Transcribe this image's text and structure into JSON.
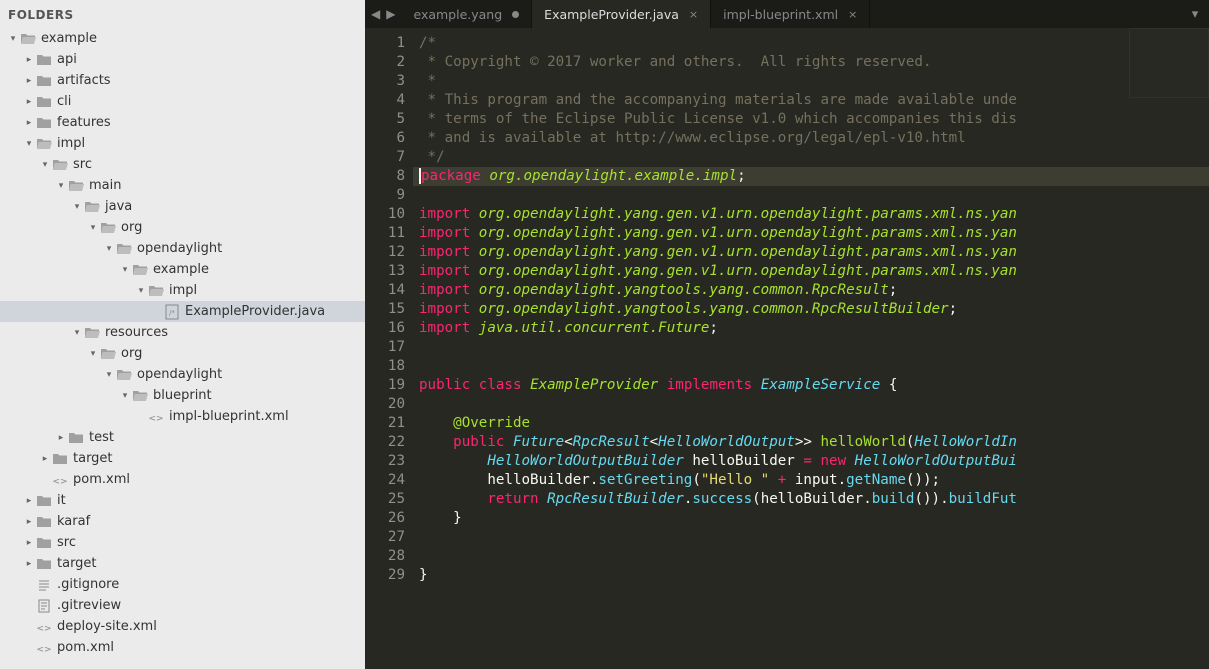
{
  "sidebar": {
    "title": "FOLDERS",
    "tree": [
      {
        "depth": 0,
        "disclosure": "down",
        "icon": "folder-open",
        "label": "example"
      },
      {
        "depth": 1,
        "disclosure": "right",
        "icon": "folder",
        "label": "api"
      },
      {
        "depth": 1,
        "disclosure": "right",
        "icon": "folder",
        "label": "artifacts"
      },
      {
        "depth": 1,
        "disclosure": "right",
        "icon": "folder",
        "label": "cli"
      },
      {
        "depth": 1,
        "disclosure": "right",
        "icon": "folder",
        "label": "features"
      },
      {
        "depth": 1,
        "disclosure": "down",
        "icon": "folder-open",
        "label": "impl"
      },
      {
        "depth": 2,
        "disclosure": "down",
        "icon": "folder-open",
        "label": "src"
      },
      {
        "depth": 3,
        "disclosure": "down",
        "icon": "folder-open",
        "label": "main"
      },
      {
        "depth": 4,
        "disclosure": "down",
        "icon": "folder-open",
        "label": "java"
      },
      {
        "depth": 5,
        "disclosure": "down",
        "icon": "folder-open",
        "label": "org"
      },
      {
        "depth": 6,
        "disclosure": "down",
        "icon": "folder-open",
        "label": "opendaylight"
      },
      {
        "depth": 7,
        "disclosure": "down",
        "icon": "folder-open",
        "label": "example"
      },
      {
        "depth": 8,
        "disclosure": "down",
        "icon": "folder-open",
        "label": "impl"
      },
      {
        "depth": 9,
        "disclosure": "",
        "icon": "file-java",
        "label": "ExampleProvider.java",
        "selected": true
      },
      {
        "depth": 4,
        "disclosure": "down",
        "icon": "folder-open",
        "label": "resources"
      },
      {
        "depth": 5,
        "disclosure": "down",
        "icon": "folder-open",
        "label": "org"
      },
      {
        "depth": 6,
        "disclosure": "down",
        "icon": "folder-open",
        "label": "opendaylight"
      },
      {
        "depth": 7,
        "disclosure": "down",
        "icon": "folder-open",
        "label": "blueprint"
      },
      {
        "depth": 8,
        "disclosure": "",
        "icon": "file-xml",
        "label": "impl-blueprint.xml"
      },
      {
        "depth": 3,
        "disclosure": "right",
        "icon": "folder",
        "label": "test"
      },
      {
        "depth": 2,
        "disclosure": "right",
        "icon": "folder",
        "label": "target"
      },
      {
        "depth": 2,
        "disclosure": "",
        "icon": "file-xml",
        "label": "pom.xml"
      },
      {
        "depth": 1,
        "disclosure": "right",
        "icon": "folder",
        "label": "it"
      },
      {
        "depth": 1,
        "disclosure": "right",
        "icon": "folder",
        "label": "karaf"
      },
      {
        "depth": 1,
        "disclosure": "right",
        "icon": "folder",
        "label": "src"
      },
      {
        "depth": 1,
        "disclosure": "right",
        "icon": "folder",
        "label": "target"
      },
      {
        "depth": 1,
        "disclosure": "",
        "icon": "file-lines",
        "label": ".gitignore"
      },
      {
        "depth": 1,
        "disclosure": "",
        "icon": "file-text",
        "label": ".gitreview"
      },
      {
        "depth": 1,
        "disclosure": "",
        "icon": "file-xml",
        "label": "deploy-site.xml"
      },
      {
        "depth": 1,
        "disclosure": "",
        "icon": "file-xml",
        "label": "pom.xml"
      }
    ]
  },
  "tabs": [
    {
      "label": "example.yang",
      "state": "dirty"
    },
    {
      "label": "ExampleProvider.java",
      "state": "active"
    },
    {
      "label": "impl-blueprint.xml",
      "state": "normal"
    }
  ],
  "editor": {
    "active_line": 8,
    "lines": [
      {
        "n": 1,
        "mark": "",
        "tokens": [
          [
            "comment",
            "/*"
          ]
        ]
      },
      {
        "n": 2,
        "mark": "",
        "tokens": [
          [
            "comment",
            " * Copyright © 2017 worker and others.  All rights reserved."
          ]
        ]
      },
      {
        "n": 3,
        "mark": "",
        "tokens": [
          [
            "comment",
            " *"
          ]
        ]
      },
      {
        "n": 4,
        "mark": "",
        "tokens": [
          [
            "comment",
            " * This program and the accompanying materials are made available unde"
          ]
        ]
      },
      {
        "n": 5,
        "mark": "",
        "tokens": [
          [
            "comment",
            " * terms of the Eclipse Public License v1.0 which accompanies this dis"
          ]
        ]
      },
      {
        "n": 6,
        "mark": "",
        "tokens": [
          [
            "comment",
            " * and is available at http://www.eclipse.org/legal/epl-v10.html"
          ]
        ]
      },
      {
        "n": 7,
        "mark": "",
        "tokens": [
          [
            "comment",
            " */"
          ]
        ]
      },
      {
        "n": 8,
        "mark": "y",
        "tokens": [
          [
            "kw",
            "package"
          ],
          [
            "plain",
            " "
          ],
          [
            "ns",
            "org.opendaylight.example.impl"
          ],
          [
            "plain",
            ";"
          ]
        ]
      },
      {
        "n": 9,
        "mark": "",
        "tokens": []
      },
      {
        "n": 10,
        "mark": "y",
        "tokens": [
          [
            "kw",
            "import"
          ],
          [
            "plain",
            " "
          ],
          [
            "ns",
            "org.opendaylight.yang.gen.v1.urn.opendaylight.params.xml.ns.yan"
          ]
        ]
      },
      {
        "n": 11,
        "mark": "y",
        "tokens": [
          [
            "kw",
            "import"
          ],
          [
            "plain",
            " "
          ],
          [
            "ns",
            "org.opendaylight.yang.gen.v1.urn.opendaylight.params.xml.ns.yan"
          ]
        ]
      },
      {
        "n": 12,
        "mark": "y",
        "tokens": [
          [
            "kw",
            "import"
          ],
          [
            "plain",
            " "
          ],
          [
            "ns",
            "org.opendaylight.yang.gen.v1.urn.opendaylight.params.xml.ns.yan"
          ]
        ]
      },
      {
        "n": 13,
        "mark": "y",
        "tokens": [
          [
            "kw",
            "import"
          ],
          [
            "plain",
            " "
          ],
          [
            "ns",
            "org.opendaylight.yang.gen.v1.urn.opendaylight.params.xml.ns.yan"
          ]
        ]
      },
      {
        "n": 14,
        "mark": "y",
        "tokens": [
          [
            "kw",
            "import"
          ],
          [
            "plain",
            " "
          ],
          [
            "ns",
            "org.opendaylight.yangtools.yang.common.RpcResult"
          ],
          [
            "plain",
            ";"
          ]
        ]
      },
      {
        "n": 15,
        "mark": "y",
        "tokens": [
          [
            "kw",
            "import"
          ],
          [
            "plain",
            " "
          ],
          [
            "ns",
            "org.opendaylight.yangtools.yang.common.RpcResultBuilder"
          ],
          [
            "plain",
            ";"
          ]
        ]
      },
      {
        "n": 16,
        "mark": "y",
        "tokens": [
          [
            "kw",
            "import"
          ],
          [
            "plain",
            " "
          ],
          [
            "ns",
            "java.util.concurrent.Future"
          ],
          [
            "plain",
            ";"
          ]
        ]
      },
      {
        "n": 17,
        "mark": "y",
        "tokens": []
      },
      {
        "n": 18,
        "mark": "y",
        "tokens": []
      },
      {
        "n": 19,
        "mark": "y",
        "tokens": [
          [
            "kw",
            "public"
          ],
          [
            "plain",
            " "
          ],
          [
            "kw",
            "class"
          ],
          [
            "plain",
            " "
          ],
          [
            "cls",
            "ExampleProvider"
          ],
          [
            "plain",
            " "
          ],
          [
            "kw",
            "implements"
          ],
          [
            "plain",
            " "
          ],
          [
            "type",
            "ExampleService"
          ],
          [
            "plain",
            " {"
          ]
        ]
      },
      {
        "n": 20,
        "mark": "y",
        "tokens": []
      },
      {
        "n": 21,
        "mark": "y",
        "tokens": [
          [
            "plain",
            "    "
          ],
          [
            "ann",
            "@Override"
          ]
        ]
      },
      {
        "n": 22,
        "mark": "y",
        "tokens": [
          [
            "plain",
            "    "
          ],
          [
            "kw",
            "public"
          ],
          [
            "plain",
            " "
          ],
          [
            "type",
            "Future"
          ],
          [
            "plain",
            "<"
          ],
          [
            "type",
            "RpcResult"
          ],
          [
            "plain",
            "<"
          ],
          [
            "type",
            "HelloWorldOutput"
          ],
          [
            "plain",
            ">> "
          ],
          [
            "funcDef",
            "helloWorld"
          ],
          [
            "plain",
            "("
          ],
          [
            "type",
            "HelloWorldIn"
          ]
        ]
      },
      {
        "n": 23,
        "mark": "y",
        "tokens": [
          [
            "plain",
            "        "
          ],
          [
            "type",
            "HelloWorldOutputBuilder"
          ],
          [
            "plain",
            " helloBuilder "
          ],
          [
            "op",
            "="
          ],
          [
            "plain",
            " "
          ],
          [
            "kw",
            "new"
          ],
          [
            "plain",
            " "
          ],
          [
            "type",
            "HelloWorldOutputBui"
          ]
        ]
      },
      {
        "n": 24,
        "mark": "y",
        "tokens": [
          [
            "plain",
            "        helloBuilder."
          ],
          [
            "func",
            "setGreeting"
          ],
          [
            "plain",
            "("
          ],
          [
            "str",
            "\"Hello \""
          ],
          [
            "plain",
            " "
          ],
          [
            "op",
            "+"
          ],
          [
            "plain",
            " input."
          ],
          [
            "func",
            "getName"
          ],
          [
            "plain",
            "());"
          ]
        ]
      },
      {
        "n": 25,
        "mark": "y",
        "tokens": [
          [
            "plain",
            "        "
          ],
          [
            "kw",
            "return"
          ],
          [
            "plain",
            " "
          ],
          [
            "type",
            "RpcResultBuilder"
          ],
          [
            "plain",
            "."
          ],
          [
            "func",
            "success"
          ],
          [
            "plain",
            "(helloBuilder."
          ],
          [
            "func",
            "build"
          ],
          [
            "plain",
            "())."
          ],
          [
            "func",
            "buildFut"
          ]
        ]
      },
      {
        "n": 26,
        "mark": "y",
        "tokens": [
          [
            "plain",
            "    }"
          ]
        ]
      },
      {
        "n": 27,
        "mark": "y",
        "tokens": []
      },
      {
        "n": 28,
        "mark": "g",
        "tokens": []
      },
      {
        "n": 29,
        "mark": "",
        "tokens": [
          [
            "plain",
            "}"
          ]
        ]
      }
    ]
  }
}
